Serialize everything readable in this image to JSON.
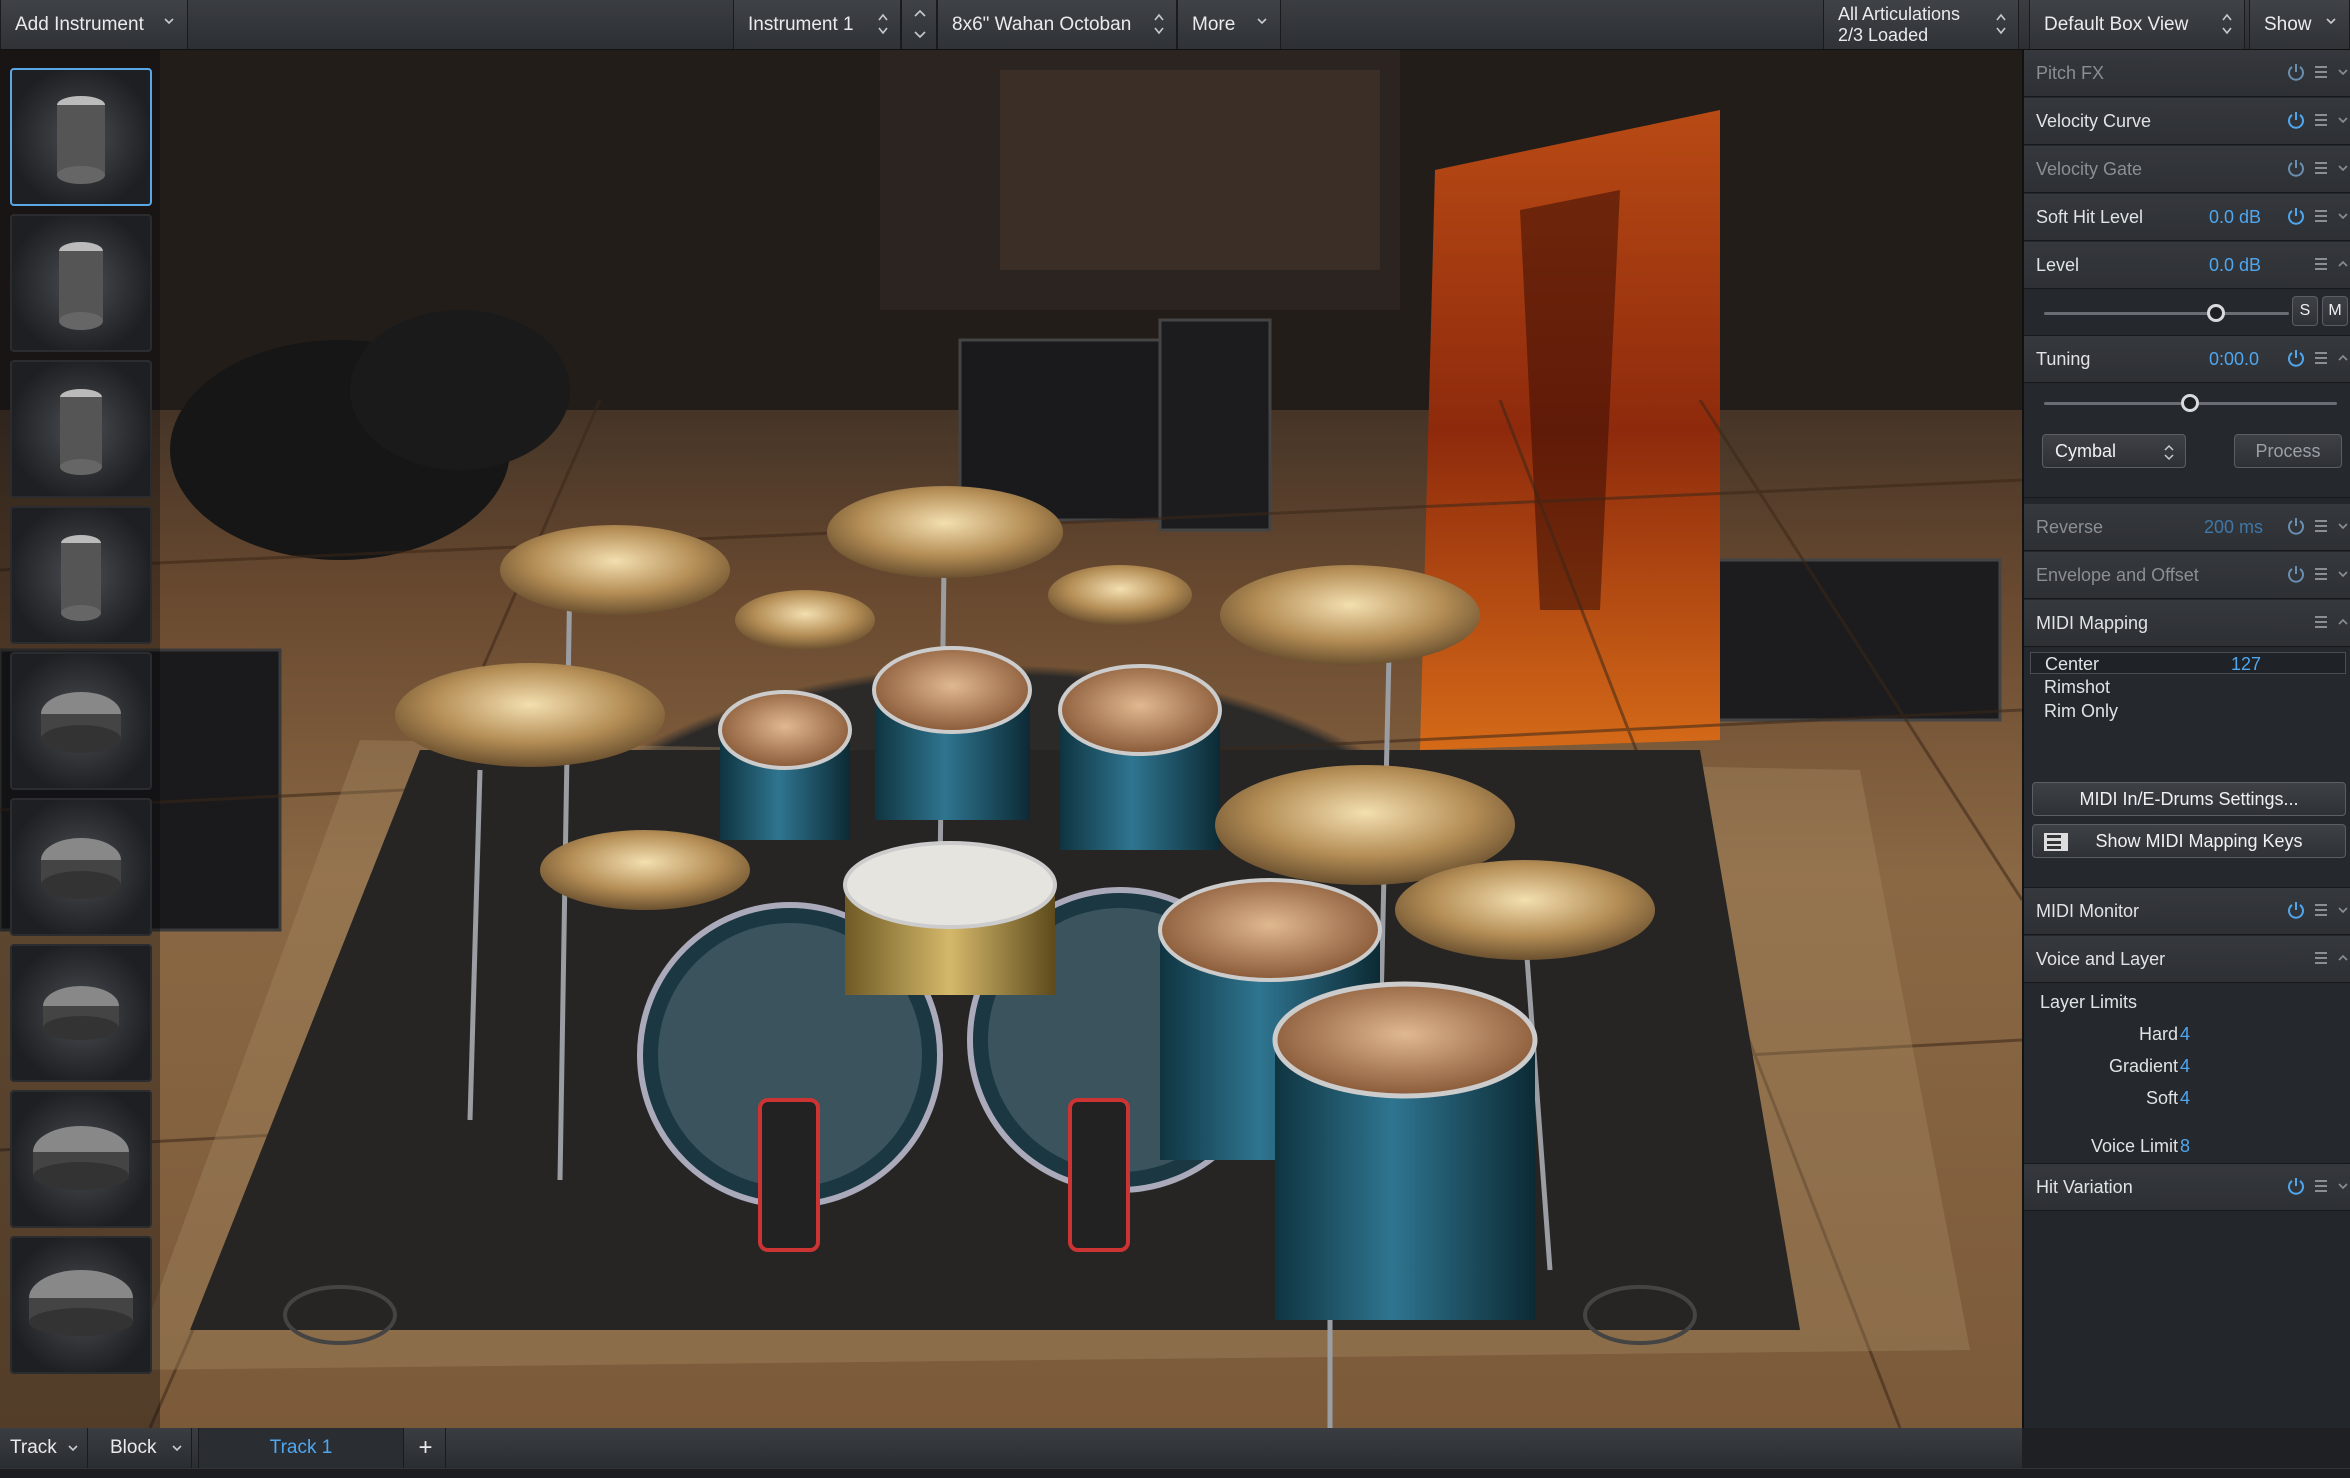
{
  "topbar": {
    "add_instrument": "Add Instrument",
    "instrument": "Instrument 1",
    "preset": "8x6\" Wahan Octoban",
    "more": "More",
    "articulations_line1": "All Articulations",
    "articulations_line2": "2/3 Loaded",
    "view": "Default Box View",
    "show": "Show"
  },
  "panel": {
    "pitch_fx": "Pitch FX",
    "velocity_curve": "Velocity Curve",
    "velocity_gate": "Velocity Gate",
    "soft_hit_level": "Soft Hit Level",
    "soft_hit_value": "0.0 dB",
    "level": "Level",
    "level_value": "0.0 dB",
    "solo": "S",
    "mute": "M",
    "tuning": "Tuning",
    "tuning_value": "0:00.0",
    "tuning_mode": "Cymbal",
    "process": "Process",
    "reverse": "Reverse",
    "reverse_value": "200 ms",
    "envelope": "Envelope and Offset",
    "midi_mapping": "MIDI Mapping",
    "mapping": [
      {
        "name": "Center",
        "value": "127"
      },
      {
        "name": "Rimshot",
        "value": ""
      },
      {
        "name": "Rim Only",
        "value": ""
      }
    ],
    "midi_settings": "MIDI In/E-Drums Settings...",
    "show_keys": "Show MIDI Mapping Keys",
    "midi_monitor": "MIDI Monitor",
    "voice_layer": "Voice and Layer",
    "layer_limits": "Layer Limits",
    "hard_label": "Hard",
    "hard_value": "4",
    "gradient_label": "Gradient",
    "gradient_value": "4",
    "soft_label": "Soft",
    "soft_value": "4",
    "voice_limit_label": "Voice Limit",
    "voice_limit_value": "8",
    "hit_variation": "Hit Variation"
  },
  "bottom": {
    "track": "Track",
    "block": "Block",
    "track_tab": "Track 1",
    "add": "+"
  },
  "colors": {
    "accent": "#4fa7f0",
    "selected_border": "#5aa7e6"
  }
}
